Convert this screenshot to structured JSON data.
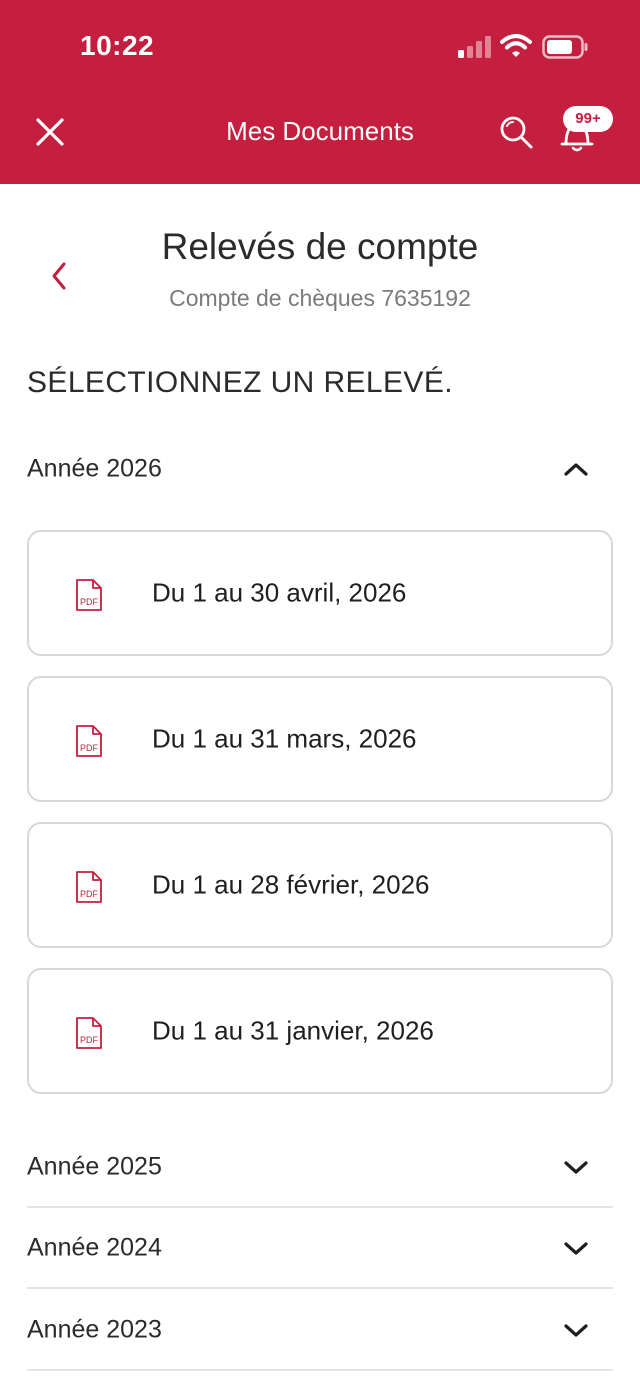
{
  "status_bar": {
    "time": "10:22"
  },
  "header": {
    "title": "Mes Documents",
    "notification_count": "99+"
  },
  "page": {
    "title": "Relevés de compte",
    "subtitle": "Compte de chèques 7635192",
    "section_title": "SÉLECTIONNEZ UN RELEVÉ."
  },
  "years": [
    {
      "label": "Année 2026",
      "expanded": true,
      "statements": [
        {
          "label": "Du 1 au 30 avril, 2026"
        },
        {
          "label": "Du 1 au 31 mars, 2026"
        },
        {
          "label": "Du 1 au 28 février, 2026"
        },
        {
          "label": "Du 1 au 31 janvier, 2026"
        }
      ]
    },
    {
      "label": "Année 2025",
      "expanded": false
    },
    {
      "label": "Année 2024",
      "expanded": false
    },
    {
      "label": "Année 2023",
      "expanded": false
    }
  ],
  "colors": {
    "brand": "#c41f3e",
    "text": "#2b2b2b",
    "muted": "#7b7b7b",
    "border": "#d8d8d8"
  },
  "icons": {
    "close": "close-icon",
    "search": "search-icon",
    "bell": "bell-icon",
    "back": "chevron-left-icon",
    "pdf": "pdf-file-icon",
    "expand": "chevron-down-icon",
    "collapse": "chevron-up-icon"
  }
}
